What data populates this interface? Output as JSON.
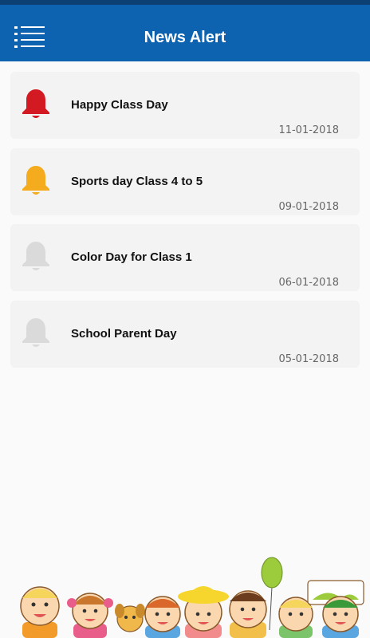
{
  "header": {
    "title": "News Alert",
    "menu_icon": "menu-icon",
    "background": "#0d63b0",
    "status_bar_color": "#0c3f74"
  },
  "alerts": [
    {
      "title": "Happy Class Day",
      "date": "11-01-2018",
      "bell_color": "#d31922",
      "icon": "bell-icon"
    },
    {
      "title": "Sports day Class 4 to 5",
      "date": "09-01-2018",
      "bell_color": "#f4ab1e",
      "icon": "bell-icon"
    },
    {
      "title": "Color Day for Class 1",
      "date": "06-01-2018",
      "bell_color": "#dadada",
      "icon": "bell-icon"
    },
    {
      "title": "School Parent Day",
      "date": "05-01-2018",
      "bell_color": "#dadada",
      "icon": "bell-icon"
    }
  ],
  "footer": {
    "illustration": "kids-illustration"
  }
}
